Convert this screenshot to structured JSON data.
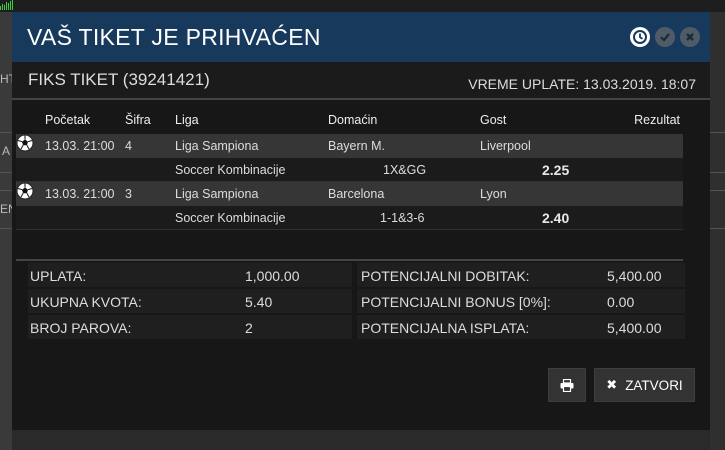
{
  "background": {
    "left_fragments": [
      "HT",
      "A",
      "EN"
    ]
  },
  "modal": {
    "title": "VAŠ TIKET JE PRIHVAĆEN",
    "header_icons": [
      "clock-icon",
      "check-circle-icon",
      "close-circle-icon"
    ]
  },
  "ticket": {
    "title": "FIKS TIKET (39241421)",
    "time": "VREME UPLATE: 13.03.2019. 18:07"
  },
  "table": {
    "headers": {
      "start": "Početak",
      "code": "Šifra",
      "league": "Liga",
      "home": "Domaćin",
      "away": "Gost",
      "result": "Rezultat"
    },
    "matches": [
      {
        "sport_icon": "soccer-ball-icon",
        "start": "13.03. 21:00",
        "code": "4",
        "league": "Liga Sampiona",
        "home": "Bayern M.",
        "away": "Liverpool",
        "result": "",
        "bet_type": "Soccer Kombinacije",
        "pick": "1X&GG",
        "odd": "2.25"
      },
      {
        "sport_icon": "soccer-ball-icon",
        "start": "13.03. 21:00",
        "code": "3",
        "league": "Liga Sampiona",
        "home": "Barcelona",
        "away": "Lyon",
        "result": "",
        "bet_type": "Soccer Kombinacije",
        "pick": "1-1&3-6",
        "odd": "2.40"
      }
    ]
  },
  "summary": {
    "left": [
      {
        "label": "UPLATA:",
        "value": "1,000.00"
      },
      {
        "label": "UKUPNA KVOTA:",
        "value": "5.40"
      },
      {
        "label": "BROJ PAROVA:",
        "value": "2"
      }
    ],
    "right": [
      {
        "label": "POTENCIJALNI DOBITAK:",
        "value": "5,400.00"
      },
      {
        "label": "POTENCIJALNI BONUS [0%]:",
        "value": "0.00"
      },
      {
        "label": "POTENCIJALNA ISPLATA:",
        "value": "5,400.00"
      }
    ]
  },
  "buttons": {
    "print_icon": "printer-icon",
    "close_label": "ZATVORI"
  },
  "colors": {
    "header_bg": "#173a5c",
    "modal_bg": "#171717",
    "match_row_bg": "#363636",
    "accent_green": "#3ccf3c"
  }
}
